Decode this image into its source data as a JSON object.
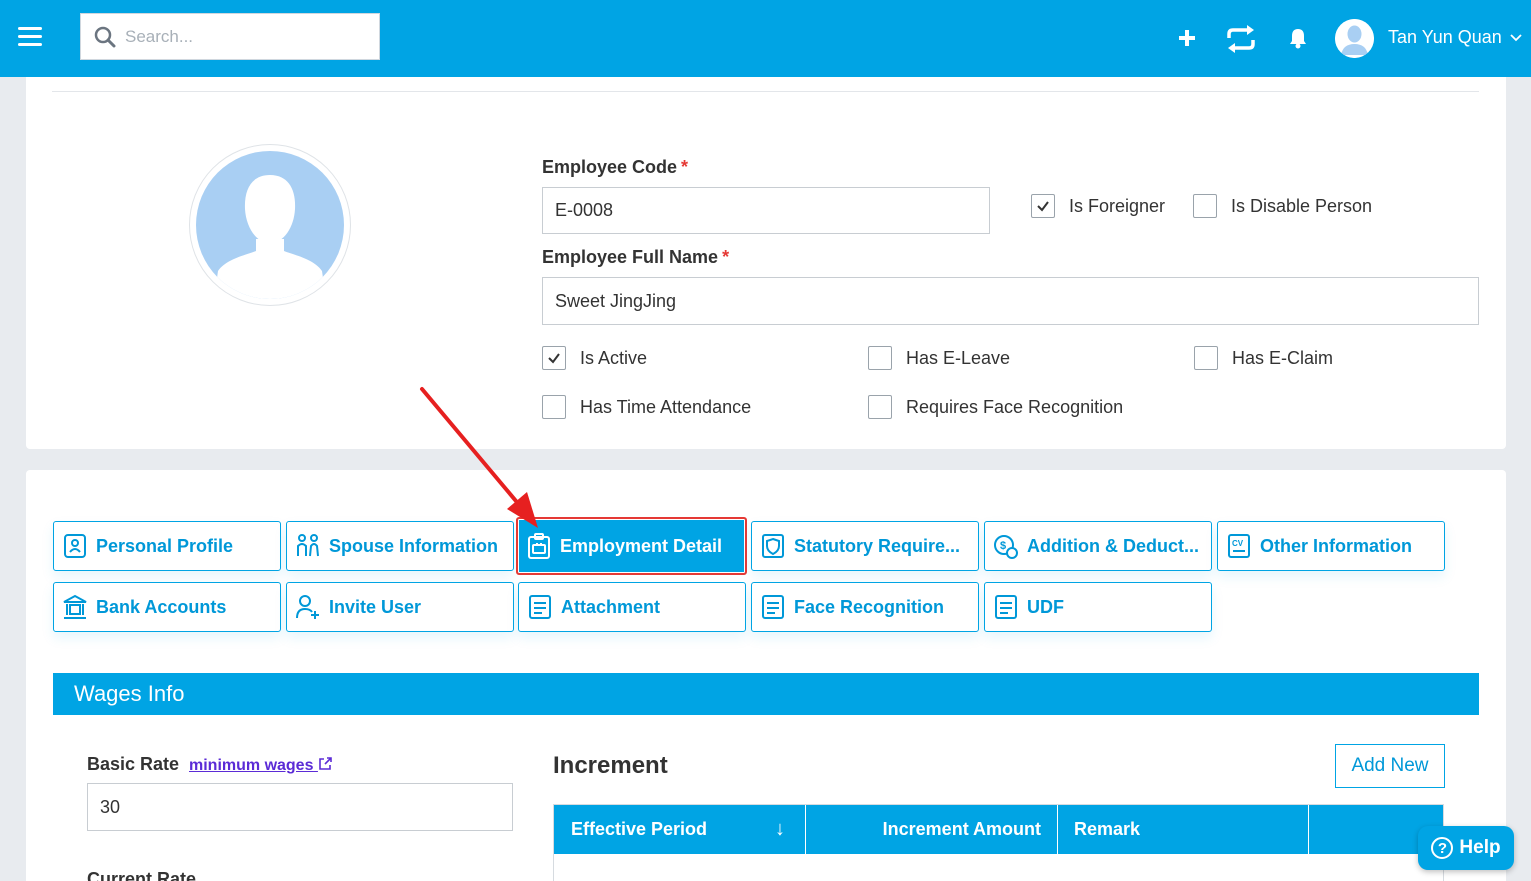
{
  "header": {
    "search_placeholder": "Search...",
    "user_name": "Tan Yun Quan"
  },
  "employee": {
    "code_label": "Employee Code",
    "code_value": "E-0008",
    "name_label": "Employee Full Name",
    "name_value": "Sweet JingJing",
    "required_mark": "*",
    "flags": {
      "is_foreigner": {
        "label": "Is Foreigner",
        "checked": true
      },
      "is_disable_person": {
        "label": "Is Disable Person",
        "checked": false
      },
      "is_active": {
        "label": "Is Active",
        "checked": true
      },
      "has_e_leave": {
        "label": "Has E-Leave",
        "checked": false
      },
      "has_e_claim": {
        "label": "Has E-Claim",
        "checked": false
      },
      "has_time_attendance": {
        "label": "Has Time Attendance",
        "checked": false
      },
      "requires_face_recognition": {
        "label": "Requires Face Recognition",
        "checked": false
      }
    }
  },
  "tabs": [
    {
      "label": "Personal Profile",
      "icon": "profile-card-icon"
    },
    {
      "label": "Spouse Information",
      "icon": "couple-icon"
    },
    {
      "label": "Employment Detail",
      "icon": "briefcase-clipboard-icon",
      "active": true
    },
    {
      "label": "Statutory Require...",
      "icon": "shield-document-icon"
    },
    {
      "label": "Addition & Deduct...",
      "icon": "money-clock-icon"
    },
    {
      "label": "Other Information",
      "icon": "cv-icon"
    },
    {
      "label": "Bank Accounts",
      "icon": "bank-icon"
    },
    {
      "label": "Invite User",
      "icon": "add-user-icon"
    },
    {
      "label": "Attachment",
      "icon": "attachment-document-icon"
    },
    {
      "label": "Face Recognition",
      "icon": "face-document-icon"
    },
    {
      "label": "UDF",
      "icon": "udf-document-icon"
    }
  ],
  "wages": {
    "section_title": "Wages Info",
    "basic_rate_label": "Basic Rate",
    "min_wages_link": "minimum wages",
    "basic_rate_value": "30",
    "current_rate_label": "Current Rate"
  },
  "increment": {
    "title": "Increment",
    "add_new_label": "Add New",
    "columns": [
      "Effective Period",
      "Increment Amount",
      "Remark",
      ""
    ],
    "sort_indicator": "↓"
  },
  "help_label": "Help",
  "colors": {
    "primary": "#00a4e4",
    "highlight": "#e53935",
    "link": "#5b2bd6"
  }
}
